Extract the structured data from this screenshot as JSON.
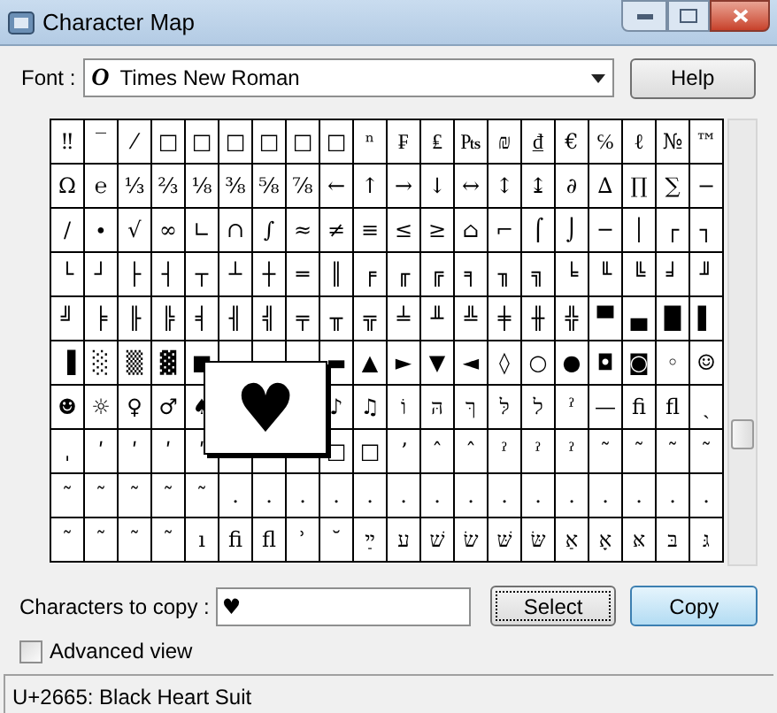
{
  "window": {
    "title": "Character Map"
  },
  "font": {
    "label": "Font :",
    "value": "Times New Roman",
    "icon_letter": "O"
  },
  "help_button": "Help",
  "grid": {
    "rows": [
      [
        "‼",
        "‾",
        "⁄",
        "□",
        "□",
        "□",
        "□",
        "□",
        "□",
        "ⁿ",
        "₣",
        "₤",
        "₧",
        "₪",
        "₫",
        "€",
        "℅",
        "ℓ",
        "№",
        "™"
      ],
      [
        "Ω",
        "℮",
        "⅓",
        "⅔",
        "⅛",
        "⅜",
        "⅝",
        "⅞",
        "←",
        "↑",
        "→",
        "↓",
        "↔",
        "↕",
        "↨",
        "∂",
        "∆",
        "∏",
        "∑",
        "−"
      ],
      [
        "∕",
        "∙",
        "√",
        "∞",
        "∟",
        "∩",
        "∫",
        "≈",
        "≠",
        "≡",
        "≤",
        "≥",
        "⌂",
        "⌐",
        "⌠",
        "⌡",
        "─",
        "│",
        "┌",
        "┐"
      ],
      [
        "└",
        "┘",
        "├",
        "┤",
        "┬",
        "┴",
        "┼",
        "═",
        "║",
        "╒",
        "╓",
        "╔",
        "╕",
        "╖",
        "╗",
        "╘",
        "╙",
        "╚",
        "╛",
        "╜"
      ],
      [
        "╝",
        "╞",
        "╟",
        "╠",
        "╡",
        "╢",
        "╣",
        "╤",
        "╥",
        "╦",
        "╧",
        "╨",
        "╩",
        "╪",
        "╫",
        "╬",
        "▀",
        "▄",
        "█",
        "▌"
      ],
      [
        "▐",
        "░",
        "▒",
        "▓",
        "■",
        null,
        null,
        null,
        "▬",
        "▲",
        "►",
        "▼",
        "◄",
        "◊",
        "○",
        "●",
        "◘",
        "◙",
        "◦",
        "☺"
      ],
      [
        "☻",
        "☼",
        "♀",
        "♂",
        "♠",
        null,
        null,
        null,
        "♪",
        "♫",
        "וֹ",
        "הּ",
        "ךּ",
        "לּ",
        "ל",
        "ˀ",
        "—",
        "ﬁ",
        "ﬂ",
        "ˏ"
      ],
      [
        "ˌ",
        "ʹ",
        "ʹ",
        "ʹ",
        "ʹ",
        null,
        null,
        null,
        "□",
        "□",
        "ʼ",
        "ˆ",
        "ˆ",
        "ˀ",
        "ˀ",
        "ˀ",
        "˜",
        "˜",
        "˜",
        "˜"
      ],
      [
        "˜",
        "˜",
        "˜",
        "˜",
        "˜",
        ".",
        ".",
        ".",
        ".",
        ".",
        ".",
        ".",
        ".",
        ".",
        ".",
        ".",
        ".",
        ".",
        ".",
        "."
      ],
      [
        "˜",
        "˜",
        "˜",
        "˜",
        "ı",
        "ﬁ",
        "ﬂ",
        "ʾ",
        "˘",
        "ײַ",
        "ע",
        "שׁ",
        "שׂ",
        "שּׁ",
        "שּׂ",
        "אַ",
        "אָ",
        "אּ",
        "בּ",
        "גּ"
      ]
    ],
    "magnified": "♥"
  },
  "copy": {
    "label": "Characters to copy :",
    "value": "♥"
  },
  "select_button": "Select",
  "copy_button": "Copy",
  "advanced_view": {
    "label": "Advanced view",
    "checked": false
  },
  "status_bar": "U+2665: Black Heart Suit"
}
